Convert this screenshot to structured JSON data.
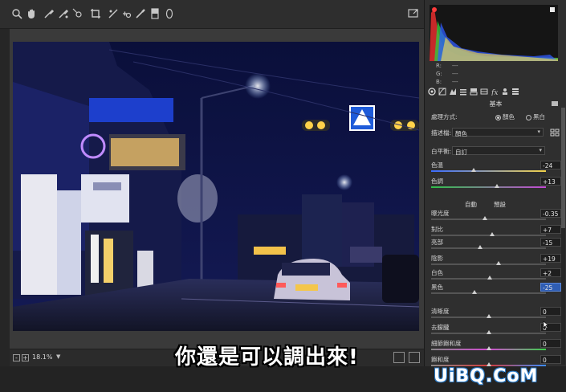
{
  "toolbar": {
    "tools": [
      "zoom-icon",
      "hand-icon",
      "white-balance-icon",
      "color-sampler-icon",
      "target-adjust-icon",
      "crop-icon",
      "straighten-icon",
      "spot-removal-icon",
      "red-eye-icon",
      "adjustment-brush-icon",
      "graduated-filter-icon",
      "radial-filter-icon"
    ],
    "fullscreen_icon": "fullscreen-toggle-icon"
  },
  "status": {
    "zoom_value": "18.1%",
    "zoom_out": "-",
    "zoom_in": "+"
  },
  "subtitle": "你還是可以調出來!",
  "watermark": "UiBQ.CoM",
  "histogram": {
    "r_label": "R:",
    "g_label": "G:",
    "b_label": "B:",
    "r_value": "---",
    "g_value": "---",
    "b_value": "---"
  },
  "panel": {
    "section_title": "基本",
    "treatment_label": "處理方式:",
    "treatment_color": "顏色",
    "treatment_bw": "黑白",
    "profile_label": "描述檔:",
    "profile_value": "顏色",
    "wb_label": "白平衡:",
    "wb_value": "自訂",
    "auto_label": "自動",
    "default_label": "預設",
    "sliders": [
      {
        "label": "色溫",
        "value": "-24",
        "pos": 0.37
      },
      {
        "label": "色調",
        "value": "+13",
        "pos": 0.57
      },
      {
        "label": "曝光度",
        "value": "-0.35",
        "pos": 0.47
      },
      {
        "label": "對比",
        "value": "+7",
        "pos": 0.53
      },
      {
        "label": "亮部",
        "value": "-15",
        "pos": 0.43
      },
      {
        "label": "陰影",
        "value": "+19",
        "pos": 0.59
      },
      {
        "label": "白色",
        "value": "+2",
        "pos": 0.51
      },
      {
        "label": "黑色",
        "value": "-25",
        "pos": 0.38
      },
      {
        "label": "清晰度",
        "value": "0",
        "pos": 0.5
      },
      {
        "label": "去朦朧",
        "value": "0",
        "pos": 0.5
      },
      {
        "label": "細節飽和度",
        "value": "0",
        "pos": 0.5
      },
      {
        "label": "飽和度",
        "value": "0",
        "pos": 0.5
      }
    ]
  },
  "colors": {
    "accent": "#2f5db3",
    "panel_bg": "#2f2f2f",
    "canvas_bg": "#3a3a3a"
  }
}
